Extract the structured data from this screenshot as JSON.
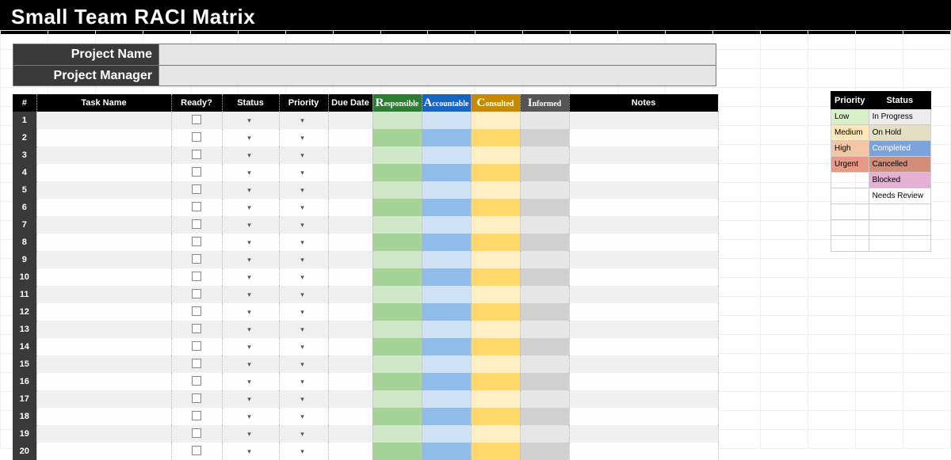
{
  "title": "Small Team RACI Matrix",
  "project": {
    "name_label": "Project Name",
    "name_value": "",
    "manager_label": "Project Manager",
    "manager_value": ""
  },
  "columns": {
    "num": "#",
    "task": "Task Name",
    "ready": "Ready?",
    "status": "Status",
    "priority": "Priority",
    "due": "Due Date",
    "responsible": "Responsible",
    "accountable": "Accountable",
    "consulted": "Consulted",
    "informed": "Informed",
    "notes": "Notes"
  },
  "rows": [
    {
      "num": "1"
    },
    {
      "num": "2"
    },
    {
      "num": "3"
    },
    {
      "num": "4"
    },
    {
      "num": "5"
    },
    {
      "num": "6"
    },
    {
      "num": "7"
    },
    {
      "num": "8"
    },
    {
      "num": "9"
    },
    {
      "num": "10"
    },
    {
      "num": "11"
    },
    {
      "num": "12"
    },
    {
      "num": "13"
    },
    {
      "num": "14"
    },
    {
      "num": "15"
    },
    {
      "num": "16"
    },
    {
      "num": "17"
    },
    {
      "num": "18"
    },
    {
      "num": "19"
    },
    {
      "num": "20"
    }
  ],
  "legend": {
    "priority_header": "Priority",
    "status_header": "Status",
    "priority": [
      "Low",
      "Medium",
      "High",
      "Urgent"
    ],
    "status": [
      "In Progress",
      "On Hold",
      "Completed",
      "Cancelled",
      "Blocked",
      "Needs Review"
    ]
  }
}
